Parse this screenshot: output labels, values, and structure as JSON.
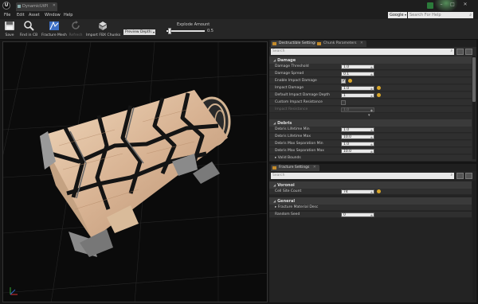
{
  "window": {
    "tab_label": "DynamicUtPl"
  },
  "menu": {
    "items": [
      "File",
      "Edit",
      "Asset",
      "Window",
      "Help"
    ],
    "search_engine": "Google",
    "help_search_placeholder": "Search For Help"
  },
  "toolbar": {
    "save": "Save",
    "find_in_cb": "Find in CB",
    "fracture_mesh": "Fracture Mesh",
    "refresh": "Refresh",
    "import_fbx_chunks": "Import FBX Chunks",
    "preview_depth": "Preview Depth: 1",
    "explode_amount_label": "Explode Amount",
    "explode_amount_value": "0.5",
    "explode_amount_fraction": 0.05
  },
  "destructible_panel": {
    "tabs": [
      "Destructible Settings",
      "Chunk Parameters"
    ],
    "search_placeholder": "Search",
    "damage": {
      "title": "Damage",
      "rows": [
        {
          "label": "Damage Threshold",
          "value": "1.0"
        },
        {
          "label": "Damage Spread",
          "value": "0.1"
        },
        {
          "label": "Enable Impact Damage",
          "checked": true
        },
        {
          "label": "Impact Damage",
          "value": "1.0"
        },
        {
          "label": "Default Impact Damage Depth",
          "value": "1"
        },
        {
          "label": "Custom Impact Resistance",
          "checked": false
        },
        {
          "label": "Impact Resistance",
          "value": "1.0"
        }
      ]
    },
    "debris": {
      "title": "Debris",
      "rows": [
        {
          "label": "Debris Lifetime Min",
          "value": "1.0"
        },
        {
          "label": "Debris Lifetime Max",
          "value": "10.0"
        },
        {
          "label": "Debris Max Separation Min",
          "value": "1.0"
        },
        {
          "label": "Debris Max Separation Max",
          "value": "10.0"
        },
        {
          "label": "Valid Bounds"
        }
      ]
    }
  },
  "fracture_panel": {
    "tab": "Fracture Settings",
    "search_placeholder": "Search",
    "voronoi": {
      "title": "Voronoi",
      "rows": [
        {
          "label": "Cell Site Count",
          "value": "74"
        }
      ]
    },
    "general": {
      "title": "General",
      "rows": [
        {
          "label": "Fracture Material Desc"
        },
        {
          "label": "Random Seed",
          "value": "0"
        }
      ]
    }
  },
  "colors": {
    "accent": "#c48b2a",
    "reset_arrow": "#d8a62a",
    "viewport_bg": "#0b0b0b",
    "mesh_light": "#e2c3a4",
    "mesh_dark": "#8a8a8a"
  }
}
